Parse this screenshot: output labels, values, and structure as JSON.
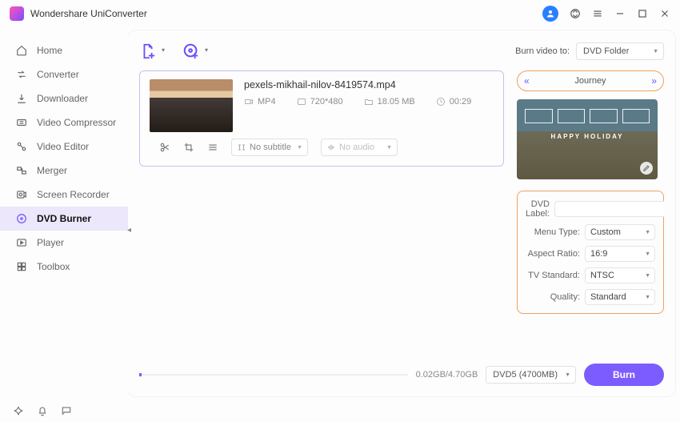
{
  "titlebar": {
    "app_name": "Wondershare UniConverter"
  },
  "sidebar": {
    "items": [
      {
        "label": "Home"
      },
      {
        "label": "Converter"
      },
      {
        "label": "Downloader"
      },
      {
        "label": "Video Compressor"
      },
      {
        "label": "Video Editor"
      },
      {
        "label": "Merger"
      },
      {
        "label": "Screen Recorder"
      },
      {
        "label": "DVD Burner"
      },
      {
        "label": "Player"
      },
      {
        "label": "Toolbox"
      }
    ]
  },
  "toolbar": {
    "burn_to_label": "Burn video to:",
    "burn_to_value": "DVD Folder"
  },
  "video": {
    "filename": "pexels-mikhail-nilov-8419574.mp4",
    "format": "MP4",
    "resolution": "720*480",
    "size": "18.05 MB",
    "duration": "00:29",
    "subtitle_value": "No subtitle",
    "audio_value": "No audio"
  },
  "template": {
    "name": "Journey",
    "preview_text": "HAPPY HOLIDAY"
  },
  "settings": {
    "dvd_label_label": "DVD Label:",
    "dvd_label_value": "",
    "menu_type_label": "Menu Type:",
    "menu_type_value": "Custom",
    "aspect_ratio_label": "Aspect Ratio:",
    "aspect_ratio_value": "16:9",
    "tv_standard_label": "TV Standard:",
    "tv_standard_value": "NTSC",
    "quality_label": "Quality:",
    "quality_value": "Standard"
  },
  "footer": {
    "size_text": "0.02GB/4.70GB",
    "disc_value": "DVD5 (4700MB)",
    "burn_label": "Burn"
  }
}
